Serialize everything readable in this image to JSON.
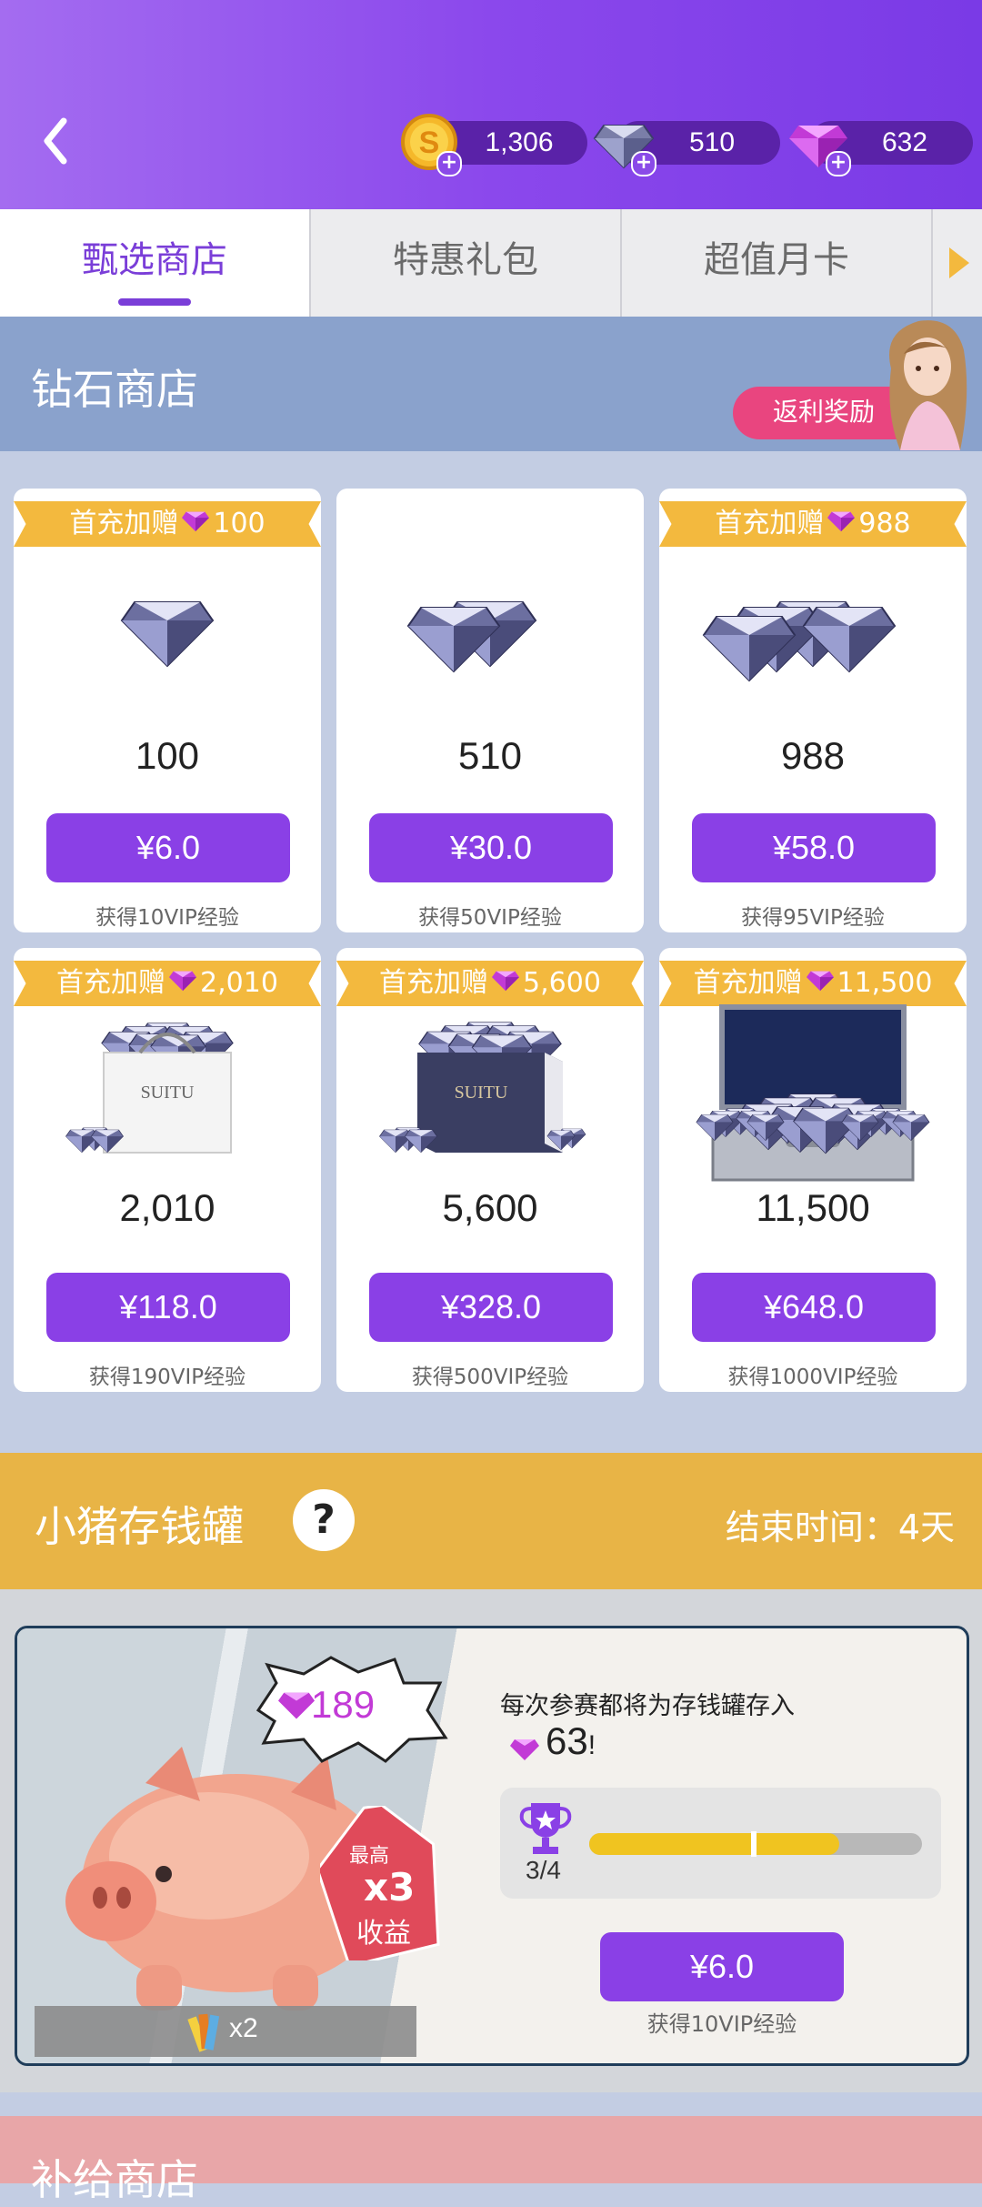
{
  "header": {
    "currencies": [
      {
        "name": "coin-icon",
        "value": "1,306"
      },
      {
        "name": "silver-diamond-icon",
        "value": "510"
      },
      {
        "name": "pink-diamond-icon",
        "value": "632"
      }
    ]
  },
  "tabs": [
    "甄选商店",
    "特惠礼包",
    "超值月卡"
  ],
  "diamond_shop": {
    "title": "钻石商店",
    "rebate_label": "返利奖励",
    "items": [
      {
        "bonus_prefix": "首充加赠",
        "bonus": "100",
        "amount": "100",
        "price": "¥6.0",
        "vip": "获得10VIP经验"
      },
      {
        "bonus_prefix": "",
        "bonus": "",
        "amount": "510",
        "price": "¥30.0",
        "vip": "获得50VIP经验"
      },
      {
        "bonus_prefix": "首充加赠",
        "bonus": "988",
        "amount": "988",
        "price": "¥58.0",
        "vip": "获得95VIP经验"
      },
      {
        "bonus_prefix": "首充加赠",
        "bonus": "2,010",
        "amount": "2,010",
        "price": "¥118.0",
        "vip": "获得190VIP经验"
      },
      {
        "bonus_prefix": "首充加赠",
        "bonus": "5,600",
        "amount": "5,600",
        "price": "¥328.0",
        "vip": "获得500VIP经验"
      },
      {
        "bonus_prefix": "首充加赠",
        "bonus": "11,500",
        "amount": "11,500",
        "price": "¥648.0",
        "vip": "获得1000VIP经验"
      }
    ],
    "bag_brand": "SUITU"
  },
  "piggy_bank": {
    "title": "小猪存钱罐",
    "help": "?",
    "end_time": "结束时间：4天",
    "stored": "189",
    "desc": "每次参赛都将为存钱罐存入",
    "per_match": "63",
    "per_match_suffix": "!",
    "progress_text": "3/4",
    "progress_fraction": 0.75,
    "tag_top": "最高",
    "tag_mult": "x3",
    "tag_bottom": "收益",
    "bonus_item": "x2",
    "price": "¥6.0",
    "vip": "获得10VIP经验"
  },
  "supply_shop": {
    "title": "补给商店"
  },
  "colors": {
    "accent": "#8a40e6",
    "ribbon": "#f3b93e",
    "piggy_header": "#e8b446"
  }
}
